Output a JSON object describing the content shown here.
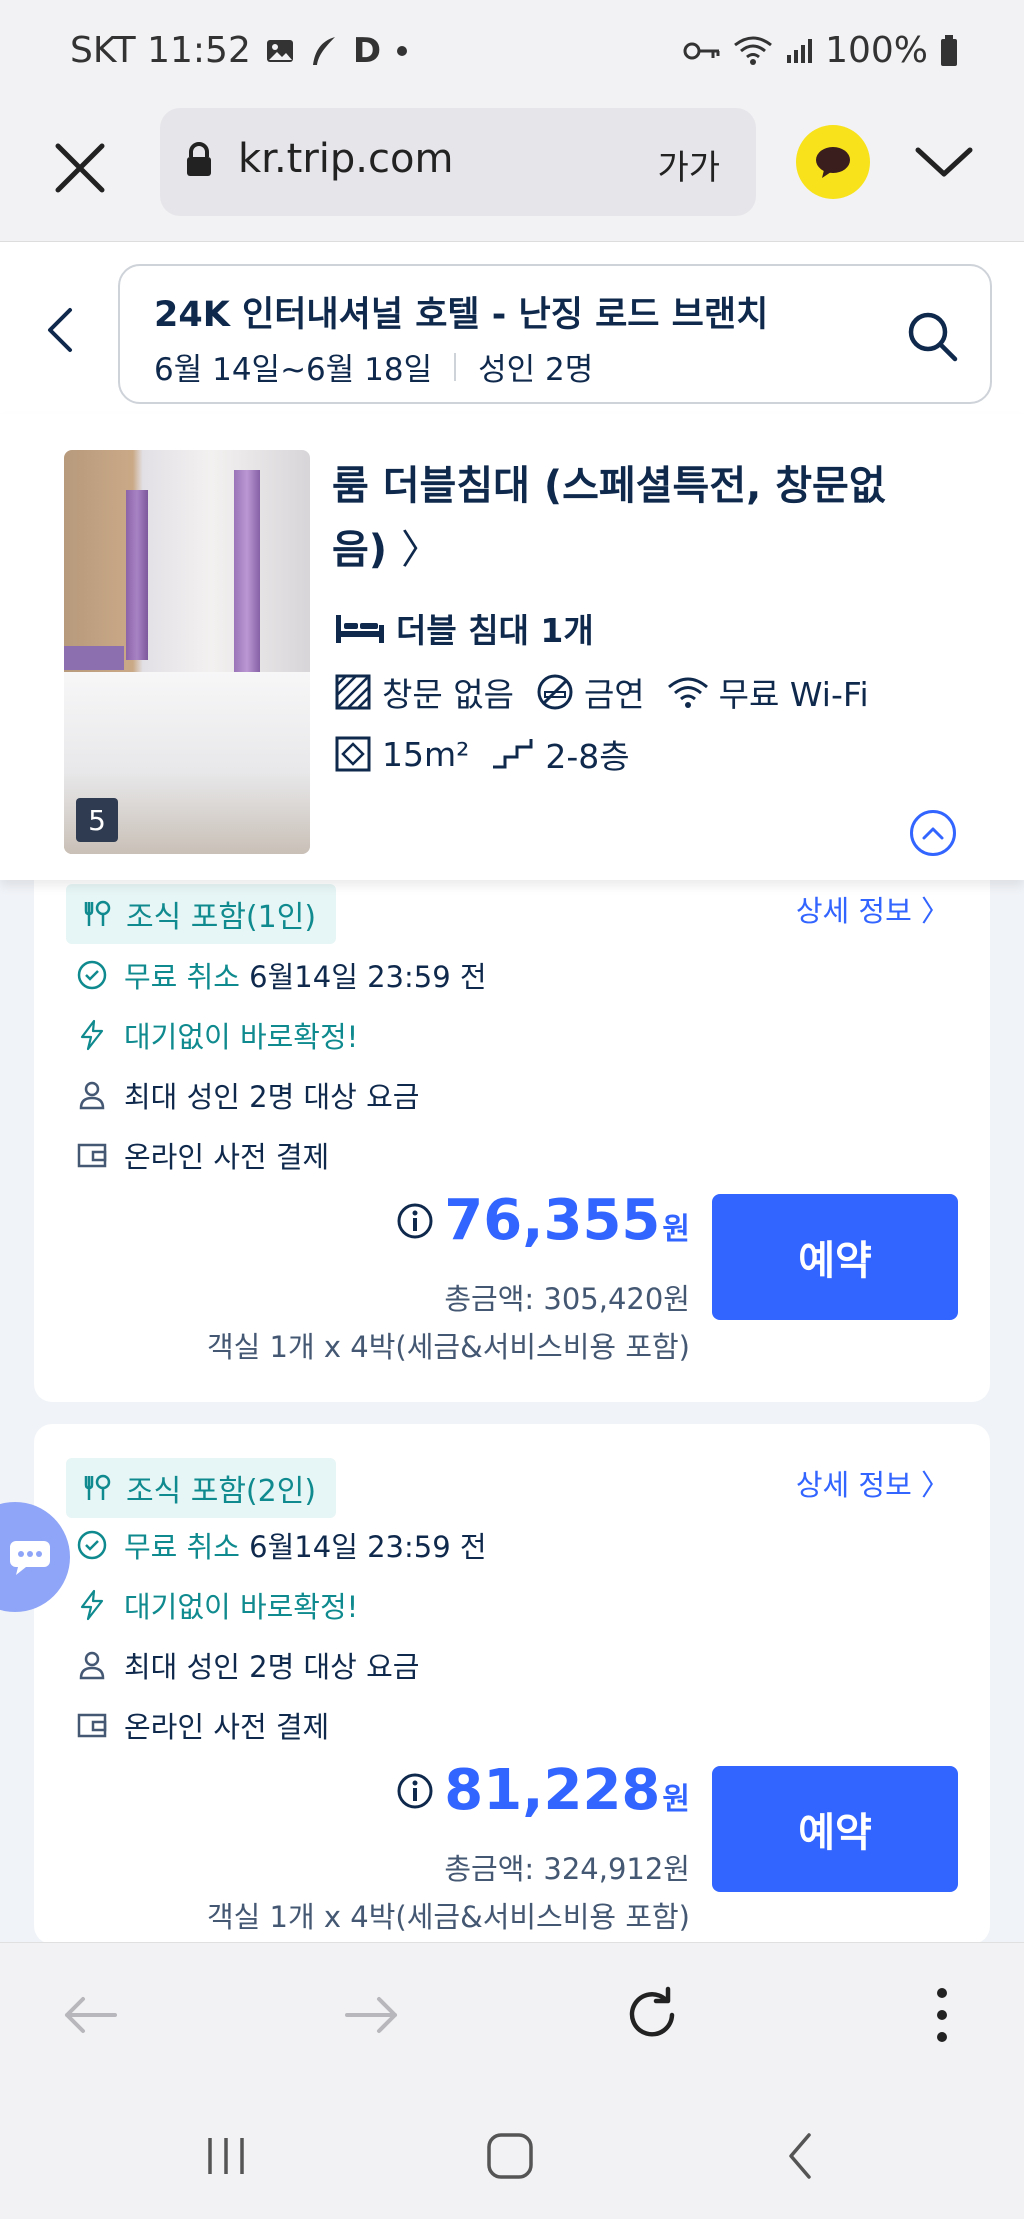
{
  "status_bar": {
    "carrier_time": "SKT 11:52",
    "battery": "100%",
    "icons": [
      "gallery-icon",
      "feather-icon",
      "d-app-icon",
      "dot-icon",
      "key-icon",
      "wifi-icon",
      "signal-icon",
      "battery-icon"
    ]
  },
  "browser": {
    "url": "kr.trip.com",
    "font_size_label": "가가",
    "icons": [
      "close-icon",
      "lock-icon",
      "kakao-talk-icon",
      "chevron-down-icon"
    ]
  },
  "search_header": {
    "title": "24K 인터내셔널 호텔 - 난징 로드 브랜치",
    "dates": "6월 14일~6월 18일",
    "guests": "성인 2명"
  },
  "room": {
    "photo_count": "5",
    "title": "룸 더블침대 (스페셜특전, 창문없음)",
    "title_arrow": "〉",
    "bed": "더블 침대 1개",
    "window": "창문 없음",
    "smoking": "금연",
    "wifi": "무료 Wi-Fi",
    "size": "15m²",
    "floor": "2-8층"
  },
  "rates": [
    {
      "breakfast": "조식 포함(1인)",
      "detail_link": "상세 정보 〉",
      "cancel_label": "무료 취소",
      "cancel_deadline": "6월14일 23:59 전",
      "instant": "대기없이 바로확정!",
      "occupancy": "최대 성인 2명 대상 요금",
      "payment": "온라인 사전 결제",
      "price": "76,355",
      "currency": "원",
      "total": "총금액: 305,420원",
      "per_stay": "객실 1개 x 4박(세금&서비스비용 포함)",
      "book": "예약"
    },
    {
      "breakfast": "조식 포함(2인)",
      "detail_link": "상세 정보 〉",
      "cancel_label": "무료 취소",
      "cancel_deadline": "6월14일 23:59 전",
      "instant": "대기없이 바로확정!",
      "occupancy": "최대 성인 2명 대상 요금",
      "payment": "온라인 사전 결제",
      "price": "81,228",
      "currency": "원",
      "total": "총금액: 324,912원",
      "per_stay": "객실 1개 x 4박(세금&서비스비용 포함)",
      "book": "예약"
    }
  ],
  "colors": {
    "accent": "#3264ff",
    "teal": "#0f8a8e",
    "navy": "#0f294d",
    "kakao": "#f7e21b"
  }
}
